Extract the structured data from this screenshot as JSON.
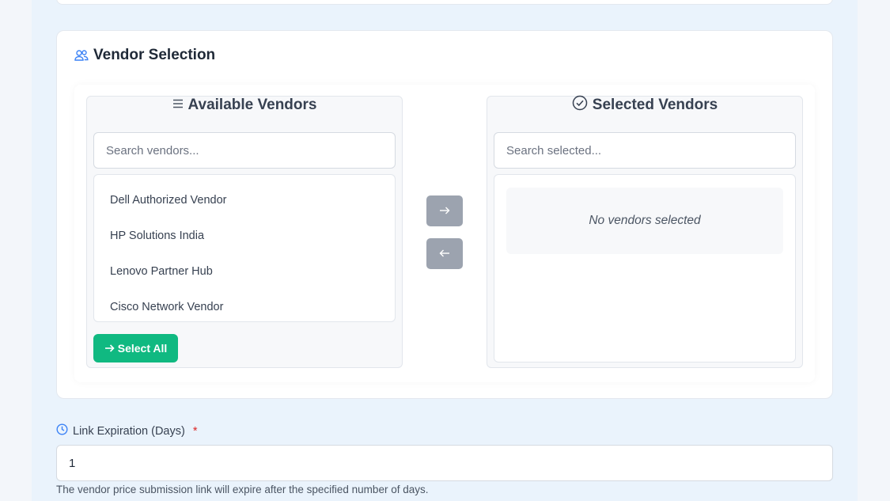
{
  "vendor_section": {
    "title": "Vendor Selection",
    "available": {
      "title": "Available Vendors",
      "search_placeholder": "Search vendors...",
      "items": [
        {
          "label": "Dell Authorized Vendor"
        },
        {
          "label": "HP Solutions India"
        },
        {
          "label": "Lenovo Partner Hub"
        },
        {
          "label": "Cisco Network Vendor"
        }
      ],
      "select_all_label": "Select All"
    },
    "selected": {
      "title": "Selected Vendors",
      "search_placeholder": "Search selected...",
      "empty_message": "No vendors selected"
    },
    "move_right_icon": "arrow-right-icon",
    "move_left_icon": "arrow-left-icon"
  },
  "link_expiration": {
    "label": "Link Expiration (Days)",
    "required_marker": "*",
    "value": "1",
    "help": "The vendor price submission link will expire after the specified number of days."
  },
  "colors": {
    "select_all_bg": "#10b981",
    "move_button_bg": "#9ca3af",
    "required": "#dc2626",
    "icon_accent": "#3b82f6",
    "page_bg": "#eaf3fc"
  }
}
